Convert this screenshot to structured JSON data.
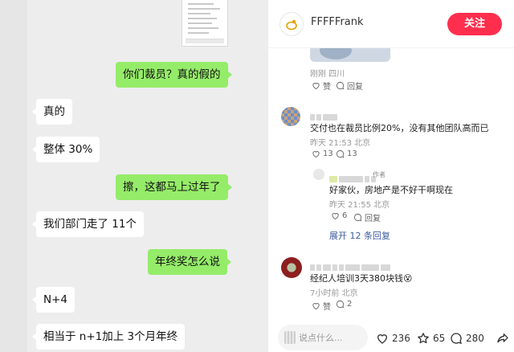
{
  "chat": {
    "messages": [
      {
        "side": "out",
        "text": "你们裁员？真的假的"
      },
      {
        "side": "in",
        "text": "真的"
      },
      {
        "side": "in",
        "text": "整体 30%"
      },
      {
        "side": "out",
        "text": "擦，这都马上过年了"
      },
      {
        "side": "in",
        "text": "我们部门走了 11个"
      },
      {
        "side": "out",
        "text": "年终奖怎么说"
      },
      {
        "side": "in",
        "text": "N+4"
      },
      {
        "side": "in",
        "text": "相当于 n+1加上 3个月年终"
      }
    ]
  },
  "header": {
    "author": "FFFFFrank",
    "follow_label": "关注"
  },
  "top_comment": {
    "meta": "刚刚 四川",
    "like_label": "赞",
    "reply_label": "回复"
  },
  "comments": [
    {
      "text": "交付也在裁员比例20%，没有其他团队高而已",
      "meta": "昨天 21:53 北京",
      "likes": "13",
      "replies": "13"
    },
    {
      "author_tag": "作者",
      "text": "好家伙，房地产是不好干啊现在",
      "meta": "昨天 21:55 北京",
      "likes": "6",
      "reply_label": "回复"
    },
    {
      "text": "经纪人培训3天380块钱😵",
      "meta": "7小时前 北京",
      "like_label": "赞",
      "replies": "2"
    }
  ],
  "expand_label": "展开 12 条回复",
  "bottom_bar": {
    "input_placeholder": "说点什么...",
    "likes": "236",
    "favorites": "65",
    "comments": "280"
  },
  "colors": {
    "follow": "#ff2e4d",
    "bubble_out": "#95ec69",
    "chat_bg": "#ededed"
  }
}
